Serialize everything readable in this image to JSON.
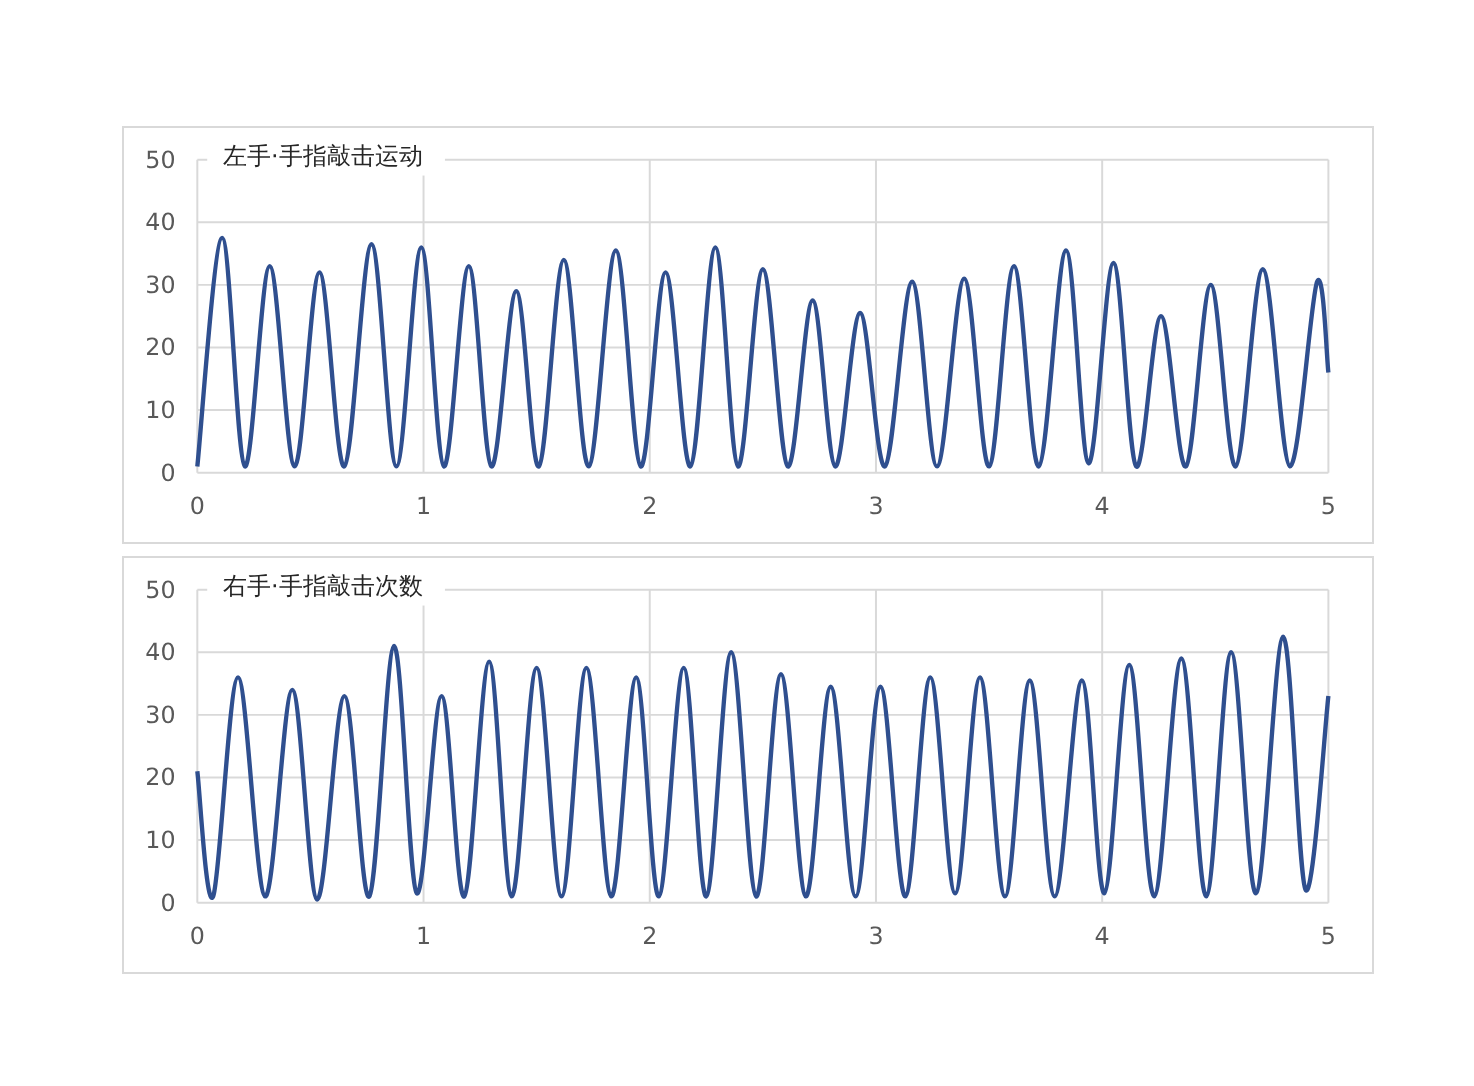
{
  "charts": [
    {
      "chart_data": {
        "type": "line",
        "title": "左手·手指敲击运动",
        "x": [
          0,
          0.11,
          0.21,
          0.32,
          0.43,
          0.54,
          0.65,
          0.77,
          0.88,
          0.99,
          1.09,
          1.2,
          1.3,
          1.41,
          1.51,
          1.62,
          1.73,
          1.85,
          1.96,
          2.07,
          2.18,
          2.29,
          2.39,
          2.5,
          2.61,
          2.72,
          2.82,
          2.93,
          3.04,
          3.16,
          3.27,
          3.39,
          3.5,
          3.61,
          3.72,
          3.84,
          3.94,
          4.05,
          4.15,
          4.26,
          4.37,
          4.48,
          4.59,
          4.71,
          4.83,
          4.95,
          5.0
        ],
        "grid": true,
        "series": [
          {
            "color": "#2f4f8f",
            "values": [
              1,
              37.5,
              1,
              33,
              1,
              32,
              1,
              36.5,
              1,
              36,
              1,
              33,
              1,
              29,
              1,
              34,
              1,
              35.5,
              1,
              32,
              1,
              36,
              1,
              32.5,
              1,
              27.5,
              1,
              25.5,
              1,
              30.5,
              1,
              31,
              1,
              33,
              1,
              35.5,
              1.5,
              33.5,
              1,
              25,
              1,
              30,
              1,
              32.5,
              1,
              30.5,
              16
            ]
          }
        ],
        "xlim": [
          0,
          5
        ],
        "ylim": [
          0,
          50
        ],
        "xticks": [
          0,
          1,
          2,
          3,
          4,
          5
        ],
        "yticks": [
          0,
          10,
          20,
          30,
          40,
          50
        ]
      }
    },
    {
      "chart_data": {
        "type": "line",
        "title": "右手·手指敲击次数",
        "x": [
          0,
          0.07,
          0.18,
          0.3,
          0.42,
          0.53,
          0.65,
          0.76,
          0.87,
          0.97,
          1.08,
          1.18,
          1.29,
          1.39,
          1.5,
          1.61,
          1.72,
          1.83,
          1.94,
          2.04,
          2.15,
          2.25,
          2.36,
          2.47,
          2.58,
          2.69,
          2.8,
          2.91,
          3.02,
          3.13,
          3.24,
          3.35,
          3.46,
          3.57,
          3.68,
          3.79,
          3.91,
          4.01,
          4.12,
          4.23,
          4.35,
          4.46,
          4.57,
          4.68,
          4.8,
          4.9,
          5.0
        ],
        "grid": true,
        "series": [
          {
            "color": "#2f4f8f",
            "values": [
              21,
              1,
              36,
              1,
              34,
              0.5,
              33,
              1,
              41,
              1.5,
              33,
              1,
              38.5,
              1,
              37.5,
              1,
              37.5,
              1,
              36,
              1,
              37.5,
              1,
              40,
              1,
              36.5,
              1,
              34.5,
              1,
              34.5,
              1,
              36,
              1.5,
              36,
              1,
              35.5,
              1,
              35.5,
              1.5,
              38,
              1,
              39,
              1,
              40,
              1.5,
              42.5,
              2,
              33
            ]
          }
        ],
        "xlim": [
          0,
          5
        ],
        "ylim": [
          0,
          50
        ],
        "xticks": [
          0,
          1,
          2,
          3,
          4,
          5
        ],
        "yticks": [
          0,
          10,
          20,
          30,
          40,
          50
        ]
      }
    }
  ]
}
